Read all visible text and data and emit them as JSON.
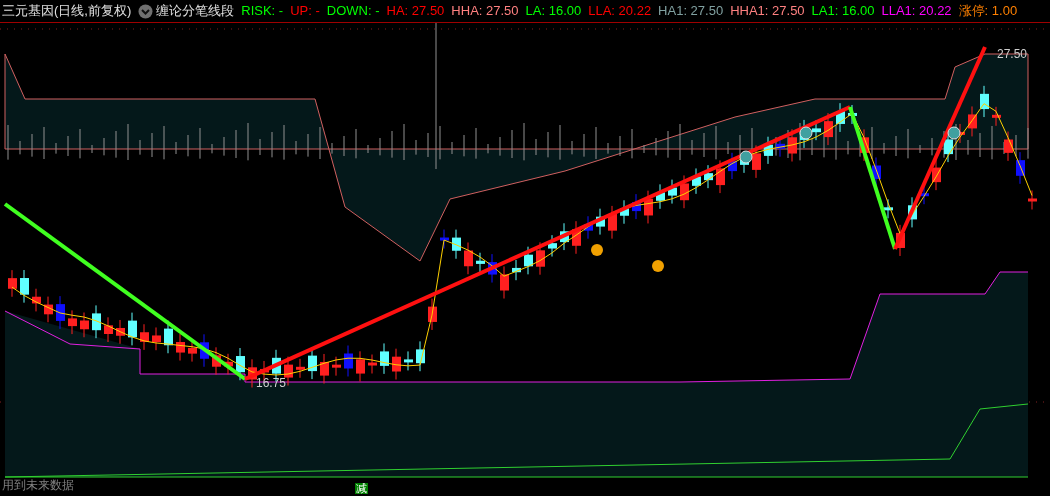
{
  "header": {
    "title": "三元基因(日线,前复权)",
    "indicator": "缠论分笔线段",
    "legend": [
      {
        "label": "RISK: -",
        "color": "#00ff00"
      },
      {
        "label": "UP: -",
        "color": "#ff0000"
      },
      {
        "label": "DOWN: -",
        "color": "#00ff00"
      },
      {
        "label": "HA: 27.50",
        "color": "#ff0000"
      },
      {
        "label": "HHA: 27.50",
        "color": "#ff8080"
      },
      {
        "label": "LA: 16.00",
        "color": "#00ff00"
      },
      {
        "label": "LLA: 20.22",
        "color": "#ff0000"
      },
      {
        "label": "HA1: 27.50",
        "color": "#80a0a0"
      },
      {
        "label": "HHA1: 27.50",
        "color": "#ff8080"
      },
      {
        "label": "LA1: 16.00",
        "color": "#00ff00"
      },
      {
        "label": "LLA1: 20.22",
        "color": "#ff00ff"
      },
      {
        "label": "涨停: 1.00",
        "color": "#ff8000"
      }
    ]
  },
  "chart": {
    "high_label": "27.50",
    "low_label": "16.75",
    "future_data_note": "用到未来数据",
    "signal_badge": "减"
  }
}
